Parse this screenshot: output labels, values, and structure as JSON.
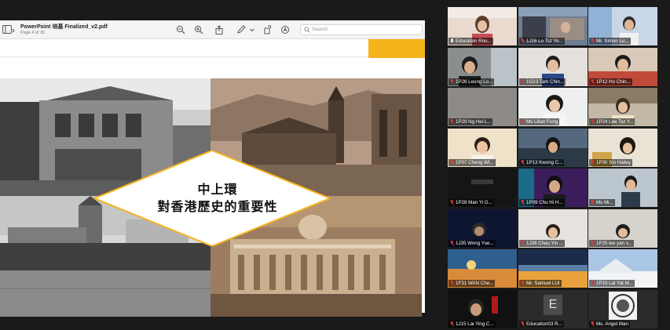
{
  "pdf": {
    "title": "PowerPoint 培基 Finalized_v2.pdf",
    "page_info": "Page 4 of 35",
    "search_placeholder": "Search",
    "icons": [
      "sidebar-icon",
      "zoom-out-icon",
      "zoom-in-icon",
      "share-icon",
      "markup-pen-icon",
      "chevron-down-icon",
      "rotate-icon",
      "annotate-icon"
    ]
  },
  "slide": {
    "title_line1": "中上環",
    "title_line2": "對香港歷史的重要性",
    "accent_color": "#f4b41a"
  },
  "participants": [
    {
      "name": "Education Rou...",
      "muted": false,
      "active": true
    },
    {
      "name": "1J26 Lo Tsz Ye...",
      "muted": true
    },
    {
      "name": "Mr. Simon Lu...",
      "muted": true
    },
    {
      "name": "1P26 Leung Lo...",
      "muted": true
    },
    {
      "name": "1G23 Tam Chin...",
      "muted": true
    },
    {
      "name": "1P12 Ho Chin...",
      "muted": true
    },
    {
      "name": "1P29 Ng Hei L...",
      "muted": true
    },
    {
      "name": "Ms Lilian Fung",
      "muted": true
    },
    {
      "name": "1P24 Lee Tsz Y...",
      "muted": true
    },
    {
      "name": "1P07 Cheng Wi...",
      "muted": true
    },
    {
      "name": "1P13 Kwong C...",
      "muted": true
    },
    {
      "name": "1P30 Sin Hailey",
      "muted": true
    },
    {
      "name": "1P28 Man Yi G...",
      "muted": true
    },
    {
      "name": "1P09 Chu Hi H...",
      "muted": true
    },
    {
      "name": "Ms Mi...",
      "muted": true
    },
    {
      "name": "1J35 Wong Yue...",
      "muted": true
    },
    {
      "name": "1J36 Chau Yin ...",
      "muted": true
    },
    {
      "name": "1P25 lee yan s...",
      "muted": true
    },
    {
      "name": "1F31 WAN Che...",
      "muted": true
    },
    {
      "name": "Mr. Samuel LUI",
      "muted": true
    },
    {
      "name": "1P19 Lai Yat M...",
      "muted": true
    },
    {
      "name": "1J15 Lai Ying C...",
      "muted": true
    },
    {
      "name": "Education03 R...",
      "muted": true,
      "avatar_letter": "E"
    },
    {
      "name": "Ms. Angel Man",
      "muted": true
    }
  ]
}
